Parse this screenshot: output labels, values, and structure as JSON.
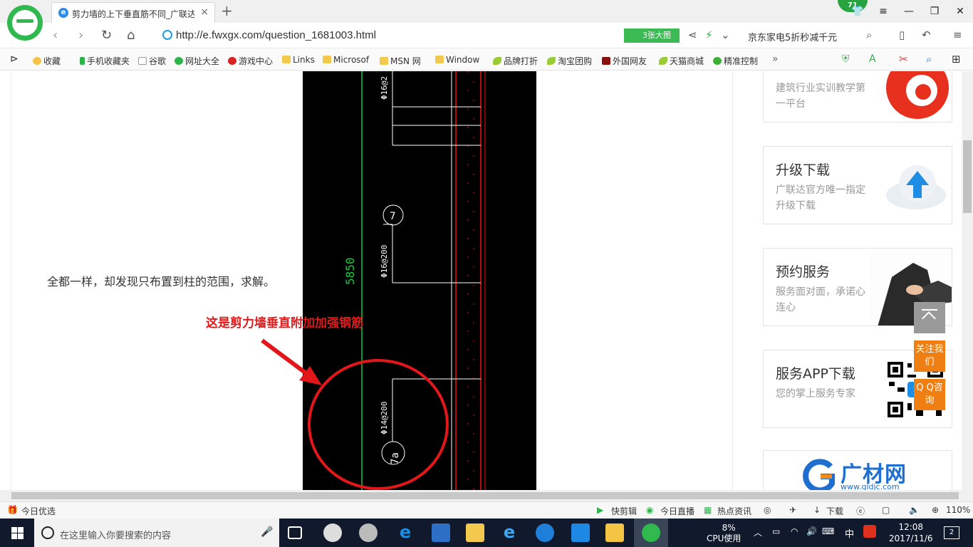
{
  "browser": {
    "tab_title": "剪力墙的上下垂直筋不同_广联达",
    "tab_close": "×",
    "new_tab": "+",
    "badge": "71",
    "url": "http://e.fwxgx.com/question_1681003.html",
    "big_image_button": "3张大图",
    "search_promo": "京东家电5折秒减千元"
  },
  "bookmarks": [
    {
      "label": "收藏",
      "icon": "star-icon"
    },
    {
      "label": "手机收藏夹",
      "icon": "phone-icon"
    },
    {
      "label": "谷歌",
      "icon": "page-icon"
    },
    {
      "label": "网址大全",
      "icon": "globe-icon"
    },
    {
      "label": "游戏中心",
      "icon": "game-icon"
    },
    {
      "label": "Links",
      "icon": "folder-icon"
    },
    {
      "label": "Microsof",
      "icon": "folder-icon"
    },
    {
      "label": "MSN 网",
      "icon": "folder-icon"
    },
    {
      "label": "Window",
      "icon": "folder-icon"
    },
    {
      "label": "品牌打折",
      "icon": "leaf-icon"
    },
    {
      "label": "淘宝团购",
      "icon": "leaf-icon"
    },
    {
      "label": "外国网友",
      "icon": "page-icon"
    },
    {
      "label": "天猫商城",
      "icon": "leaf-icon"
    },
    {
      "label": "精准控制",
      "icon": "wechat-icon"
    }
  ],
  "bookmarks_more": "»",
  "page": {
    "question_text": "全都一样，却发现只布置到柱的范围，求解。",
    "annotation": "这是剪力墙垂直附加加强钢筋",
    "cad": {
      "dimension": "5850",
      "rebar_top": "Φ16@2",
      "rebar_mid": "Φ16@200",
      "rebar_bottom": "Φ14@200",
      "tag_7": "7",
      "tag_7a": "7a"
    }
  },
  "sidebar": {
    "card1": {
      "desc": "建筑行业实训教学第一平台"
    },
    "card2": {
      "title": "升级下载",
      "desc": "广联达官方唯一指定升级下载"
    },
    "card3": {
      "title": "预约服务",
      "desc": "服务面对面，承诺心连心"
    },
    "card4": {
      "title": "服务APP下载",
      "desc": "您的掌上服务专家"
    },
    "card5": {
      "logo_text": "广材网",
      "logo_url": "www.gldjc.com"
    },
    "follow_button": "关注我们",
    "qq_button": "Q Q咨询"
  },
  "statusbar": {
    "today_picks": "今日优选",
    "quick_clip": "快剪辑",
    "today_live": "今日直播",
    "hot_news": "热点资讯",
    "download": "下载",
    "zoom": "110%"
  },
  "taskbar": {
    "search_placeholder": "在这里输入你要搜索的内容",
    "cpu_percent": "8%",
    "cpu_label": "CPU使用",
    "ime": "中",
    "time": "12:08",
    "date": "2017/11/6",
    "notifications": "2"
  }
}
